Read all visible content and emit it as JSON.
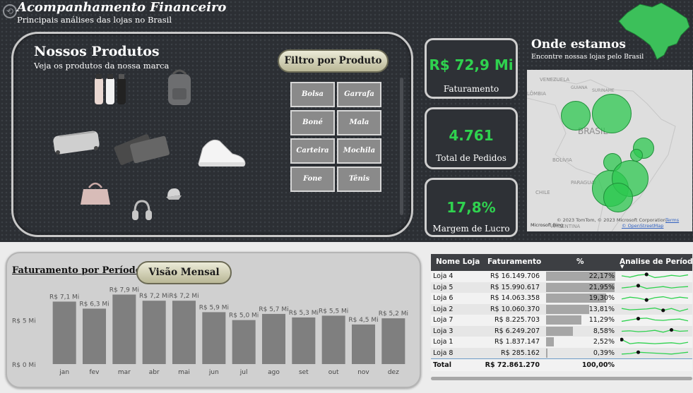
{
  "header": {
    "title": "Acompanhamento Financeiro",
    "subtitle": "Principais análises das lojas no Brasil",
    "back_icon": "back-arrow-icon"
  },
  "products": {
    "title": "Nossos Produtos",
    "subtitle": "Veja os produtos  da nossa marca",
    "filter_title": "Filtro por Produto",
    "filters": [
      "Bolsa",
      "Garrafa",
      "Boné",
      "Mala",
      "Carteira",
      "Mochila",
      "Fone",
      "Tênis"
    ],
    "images": [
      "garrafas",
      "mochila",
      "mala",
      "carteira",
      "tenis",
      "bolsa",
      "fone",
      "bone"
    ]
  },
  "kpis": {
    "faturamento": {
      "value": "R$ 72,9 Mi",
      "label": "Faturamento"
    },
    "pedidos": {
      "value": "4.761",
      "label": "Total de Pedidos"
    },
    "margem": {
      "value": "17,8%",
      "label": "Margem de Lucro"
    }
  },
  "map": {
    "title": "Onde estamos",
    "subtitle": "Encontre nossas lojas pelo Brasil",
    "labels": [
      "VENEZUELA",
      "GUIANA",
      "SURINAME",
      "LÔMBIA",
      "BRASIL",
      "BOLÍVIA",
      "PARAGUAI",
      "CHILE",
      "ARGENTINA"
    ],
    "attribution": "© 2023 TomTom, © 2023 Microsoft Corporation,",
    "terms_link": "Terms",
    "osm_link": "© OpenStreetMap",
    "brand": "Microsoft Bing",
    "bubble_color": "#2ec850"
  },
  "period": {
    "title": "Faturamento por Período",
    "view_button": "Visão Mensal"
  },
  "chart_data": {
    "type": "bar",
    "categories": [
      "jan",
      "fev",
      "mar",
      "abr",
      "mai",
      "jun",
      "jul",
      "ago",
      "set",
      "out",
      "nov",
      "dez"
    ],
    "values": [
      7.1,
      6.3,
      7.9,
      7.2,
      7.2,
      5.9,
      5.0,
      5.7,
      5.3,
      5.5,
      4.5,
      5.2
    ],
    "data_labels": [
      "R$ 7,1 Mi",
      "R$ 6,3 Mi",
      "R$ 7,9 Mi",
      "R$ 7,2 Mi",
      "R$ 7,2 Mi",
      "R$ 5,9 Mi",
      "R$ 5,0 Mi",
      "R$ 5,7 Mi",
      "R$ 5,3 Mi",
      "R$ 5,5 Mi",
      "R$ 4,5 Mi",
      "R$ 5,2 Mi"
    ],
    "ytick_labels": [
      "R$ 0 Mi",
      "R$ 5 Mi"
    ],
    "yticks": [
      0,
      5
    ],
    "ylim": [
      0,
      8.5
    ],
    "bar_color": "#7f7f7f"
  },
  "table": {
    "headers": [
      "Nome Loja",
      "Faturamento",
      "%",
      "Analise de Período"
    ],
    "rows": [
      {
        "loja": "Loja 4",
        "faturamento": "R$ 16.149.706",
        "pct": "22,17%",
        "pct_value": 22.17,
        "spark": [
          0.55,
          0.4,
          0.62,
          0.7,
          0.35,
          0.45,
          0.6,
          0.5,
          0.65
        ],
        "dot": 3
      },
      {
        "loja": "Loja 5",
        "faturamento": "R$ 15.990.617",
        "pct": "21,95%",
        "pct_value": 21.95,
        "spark": [
          0.45,
          0.55,
          0.7,
          0.4,
          0.5,
          0.6,
          0.45,
          0.55,
          0.6
        ],
        "dot": 2
      },
      {
        "loja": "Loja 6",
        "faturamento": "R$ 14.063.358",
        "pct": "19,30%",
        "pct_value": 19.3,
        "spark": [
          0.4,
          0.6,
          0.5,
          0.3,
          0.55,
          0.65,
          0.45,
          0.6,
          0.5
        ],
        "dot": 3
      },
      {
        "loja": "Loja 2",
        "faturamento": "R$ 10.060.370",
        "pct": "13,81%",
        "pct_value": 13.81,
        "spark": [
          0.6,
          0.45,
          0.5,
          0.55,
          0.65,
          0.4,
          0.6,
          0.3,
          0.55
        ],
        "dot": 5
      },
      {
        "loja": "Loja 7",
        "faturamento": "R$ 8.225.703",
        "pct": "11,29%",
        "pct_value": 11.29,
        "spark": [
          0.35,
          0.5,
          0.65,
          0.7,
          0.5,
          0.45,
          0.55,
          0.6,
          0.4
        ],
        "dot": 2
      },
      {
        "loja": "Loja 3",
        "faturamento": "R$ 6.249.207",
        "pct": "8,58%",
        "pct_value": 8.58,
        "spark": [
          0.5,
          0.55,
          0.45,
          0.5,
          0.6,
          0.4,
          0.65,
          0.5,
          0.55
        ],
        "dot": 6
      },
      {
        "loja": "Loja 1",
        "faturamento": "R$ 1.837.147",
        "pct": "2,52%",
        "pct_value": 2.52,
        "spark": [
          0.75,
          0.3,
          0.4,
          0.35,
          0.3,
          0.35,
          0.4,
          0.3,
          0.45
        ],
        "dot": 0
      },
      {
        "loja": "Loja 8",
        "faturamento": "R$ 285.162",
        "pct": "0,39%",
        "pct_value": 0.39,
        "spark": [
          0.4,
          0.45,
          0.6,
          0.55,
          0.5,
          0.45,
          0.4,
          0.5,
          0.6
        ],
        "dot": 2
      }
    ],
    "total": {
      "label": "Total",
      "faturamento": "R$ 72.861.270",
      "pct": "100,00%"
    },
    "spark_color": "#2fd24f"
  }
}
